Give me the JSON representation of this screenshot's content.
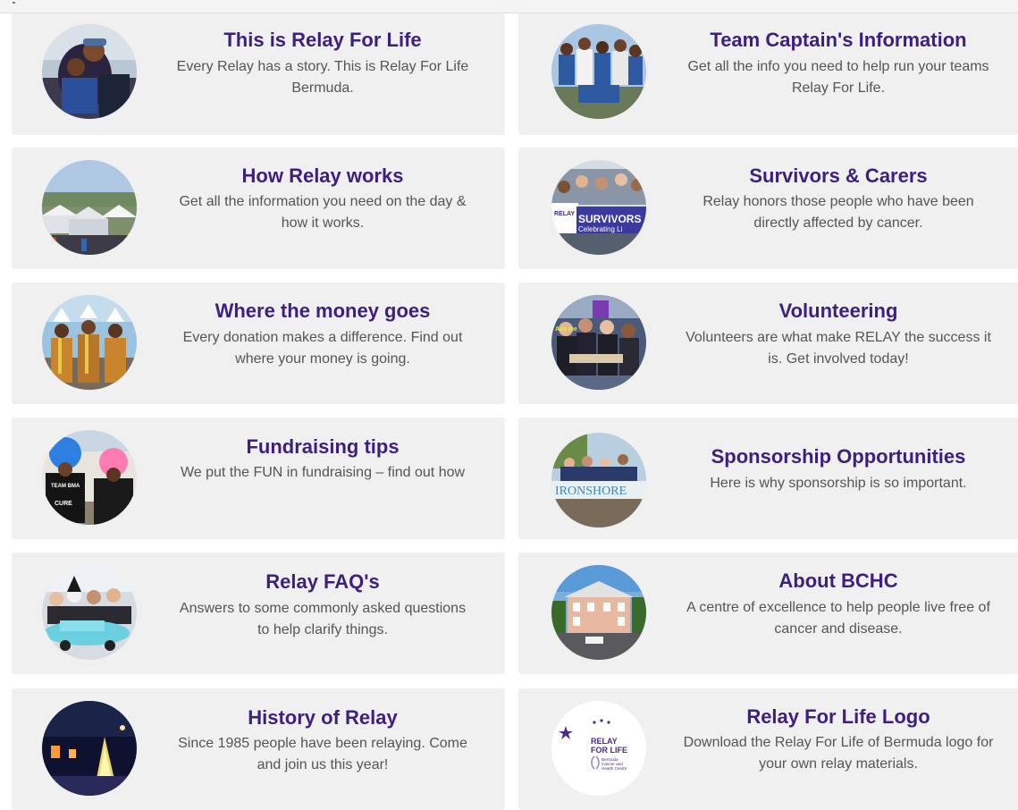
{
  "cards": [
    {
      "title": "This is Relay For Life",
      "desc": "Every Relay has a story. This is Relay For Life Bermuda.",
      "image": "relay-hug-photo"
    },
    {
      "title": "Team Captain's Information",
      "desc": "Get all the info you need to help run your teams Relay For Life.",
      "image": "team-captains-photo"
    },
    {
      "title": "How Relay works",
      "desc": "Get all the information you need on the day & how it works.",
      "image": "relay-field-tents-photo"
    },
    {
      "title": "Survivors & Carers",
      "desc": "Relay honors those people who have been directly affected by cancer.",
      "image": "survivors-banner-photo"
    },
    {
      "title": "Where the money goes",
      "desc": "Every donation makes a difference. Find out where your money is going.",
      "image": "costumed-participants-photo"
    },
    {
      "title": "Volunteering",
      "desc": "Volunteers are what make RELAY the success it is. Get involved today!",
      "image": "volunteers-group-photo"
    },
    {
      "title": "Fundraising tips",
      "desc": "We put the FUN in fundraising – find out how",
      "image": "colorful-wigs-photo"
    },
    {
      "title": "Sponsorship Opportunities",
      "desc": "Here is why sponsorship is so important.",
      "image": "ironshore-banner-photo"
    },
    {
      "title": "Relay FAQ's",
      "desc": "Answers to some commonly asked questions to help clarify things.",
      "image": "car-costume-photo"
    },
    {
      "title": "About BCHC",
      "desc": "A centre of excellence to help people live free of cancer and disease.",
      "image": "bchc-building-photo"
    },
    {
      "title": "History of Relay",
      "desc": "Since 1985 people have been relaying. Come and join us this year!",
      "image": "luminaria-bags-photo"
    },
    {
      "title": "Relay For Life Logo",
      "desc": "Download the Relay For Life of Bermuda logo for your own relay materials.",
      "image": "relay-logo"
    }
  ],
  "logo": {
    "line1": "RELAY",
    "line2": "FOR LIFE",
    "line3": "Bermuda",
    "line4": "Cancer and",
    "line5": "Health Centre"
  },
  "photo_texts": {
    "survivors": "SURVIVORS",
    "celebrating": "Celebrating Li",
    "ironshore": "IRONSHORE",
    "team_bma": "TEAM BMA",
    "cure": "CURE",
    "ask_me": "Ask me"
  },
  "colors": {
    "title": "#3f1f7e",
    "text": "#555555",
    "card_bg": "#f0f0f0",
    "logo_purple": "#4a2a8c"
  }
}
